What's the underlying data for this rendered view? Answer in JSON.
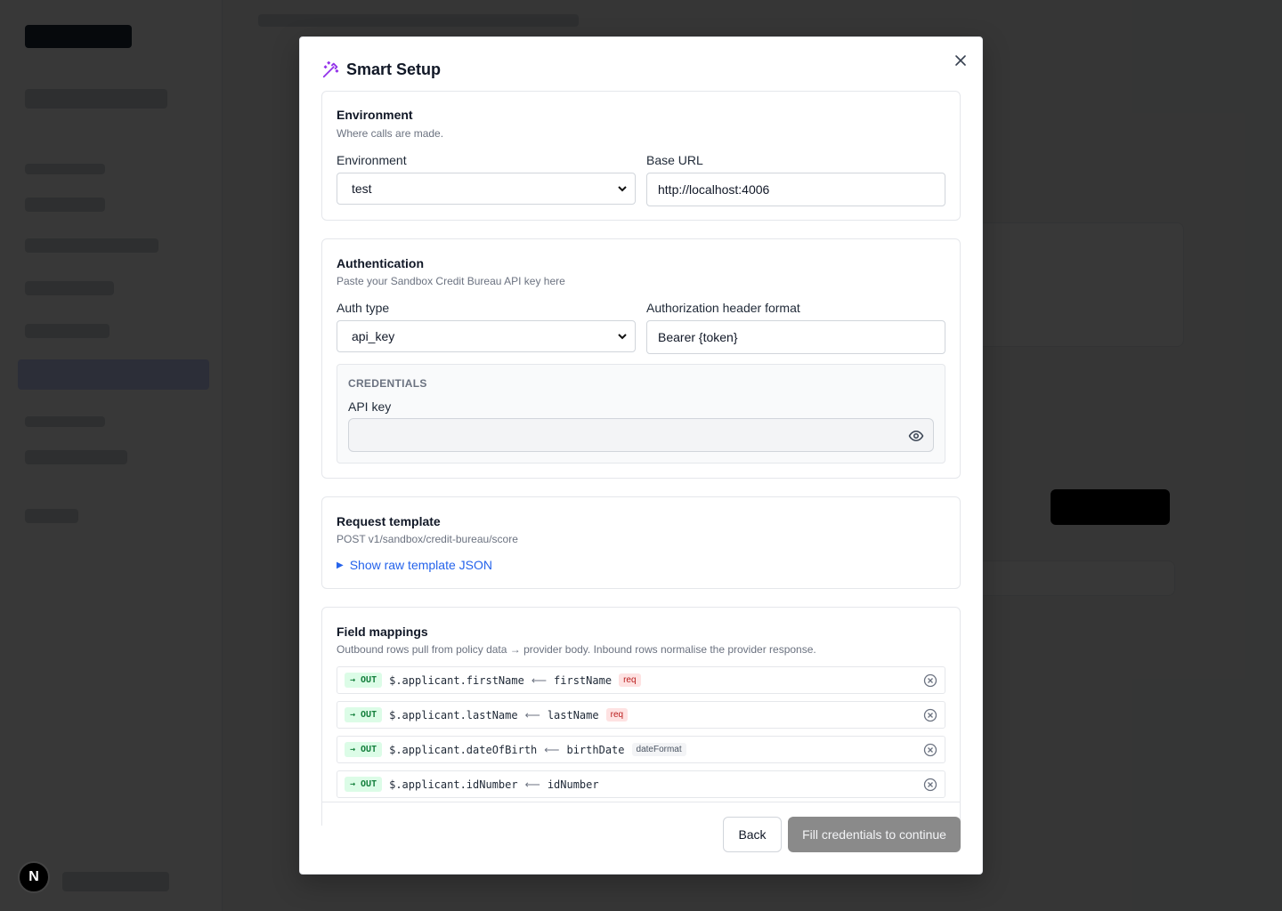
{
  "modal": {
    "title": "Smart Setup",
    "close_icon": "close-icon",
    "title_icon": "magic-wand-icon",
    "accent_color": "#9333ea"
  },
  "environment": {
    "title": "Environment",
    "subtitle": "Where calls are made.",
    "env_label": "Environment",
    "env_value": "test",
    "base_url_label": "Base URL",
    "base_url_value": "http://localhost:4006"
  },
  "authentication": {
    "title": "Authentication",
    "subtitle": "Paste your Sandbox Credit Bureau API key here",
    "auth_type_label": "Auth type",
    "auth_type_value": "api_key",
    "header_format_label": "Authorization header format",
    "header_format_value": "Bearer {token}",
    "credentials_heading": "CREDENTIALS",
    "api_key_label": "API key",
    "api_key_value": ""
  },
  "request_template": {
    "title": "Request template",
    "subtitle": "POST v1/sandbox/credit-bureau/score",
    "toggle_label": "Show raw template JSON"
  },
  "field_mappings": {
    "title": "Field mappings",
    "subtitle": "Outbound rows pull from policy data → provider body. Inbound rows normalise the provider response.",
    "rows": [
      {
        "direction": "→ OUT",
        "target": "$.applicant.firstName",
        "arrow": "⟵",
        "source": "firstName",
        "tag": "req",
        "tag_kind": "req"
      },
      {
        "direction": "→ OUT",
        "target": "$.applicant.lastName",
        "arrow": "⟵",
        "source": "lastName",
        "tag": "req",
        "tag_kind": "req"
      },
      {
        "direction": "→ OUT",
        "target": "$.applicant.dateOfBirth",
        "arrow": "⟵",
        "source": "birthDate",
        "tag": "dateFormat",
        "tag_kind": "fmt"
      },
      {
        "direction": "→ OUT",
        "target": "$.applicant.idNumber",
        "arrow": "⟵",
        "source": "idNumber",
        "tag": "",
        "tag_kind": ""
      }
    ]
  },
  "footer": {
    "back_label": "Back",
    "primary_label": "Fill credentials to continue"
  },
  "background": {
    "next_badge": "N"
  }
}
